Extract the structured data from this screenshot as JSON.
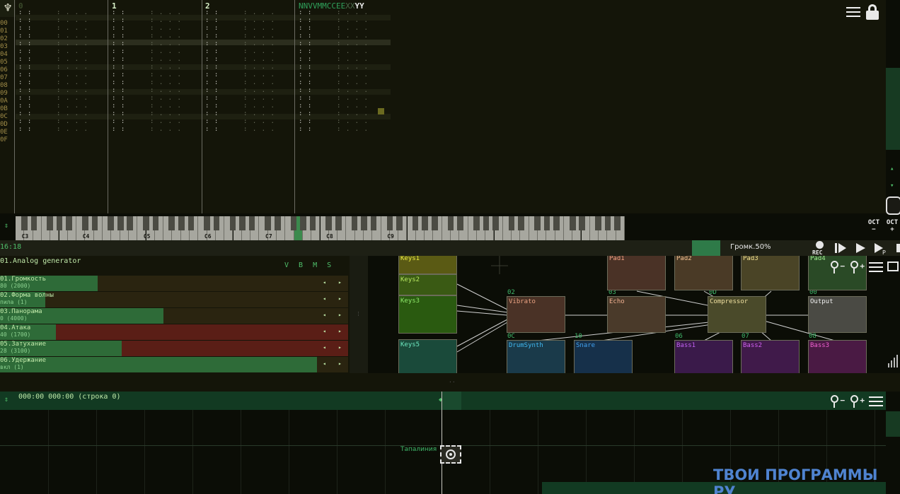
{
  "pattern": {
    "channels": [
      {
        "num": "0"
      },
      {
        "num": "1"
      },
      {
        "num": "2"
      }
    ],
    "columns_header_green": "NNVVMMCCEE",
    "columns_header_dim": "XX",
    "columns_header_white": "YY",
    "row_numbers": "00\n01\n02\n03\n04\n05\n06\n07\n08\n09\n0A\n0B\n0C\n0D\n0E\n0F"
  },
  "piano": {
    "octaves": [
      "C3",
      "C4",
      "C5",
      "C6",
      "C7",
      "C8",
      "C9"
    ],
    "oct_down": "OCT\n−",
    "oct_up": "OCT\n+"
  },
  "status": {
    "time": "16:18",
    "volume_label": "Громк.50%",
    "rec_label": "REC"
  },
  "module": {
    "title": "01.Analog generator",
    "vbms": [
      "V",
      "B",
      "M",
      "S"
    ],
    "params": [
      {
        "name": "01.Громкость",
        "value": "80 (2000)",
        "fill": 0.28,
        "red": 0
      },
      {
        "name": "02.Форма волны",
        "value": "пила (1)",
        "fill": 0.13,
        "red": 0
      },
      {
        "name": "03.Панорама",
        "value": "0 (4000)",
        "fill": 0.47,
        "red": 0
      },
      {
        "name": "04.Атака",
        "value": "40 (1700)",
        "fill": 0.16,
        "red": 1
      },
      {
        "name": "05.Затухание",
        "value": "28 (3100)",
        "fill": 0.35,
        "red": 1
      },
      {
        "name": "06.Удержание",
        "value": "вкл (1)",
        "fill": 0.91,
        "red": 0
      }
    ]
  },
  "graph": {
    "nodes": [
      {
        "label": "Keys1",
        "id": ""
      },
      {
        "label": "Keys2",
        "id": ""
      },
      {
        "label": "Keys3",
        "id": ""
      },
      {
        "label": "Keys5",
        "id": ""
      },
      {
        "label": "Vibrato",
        "id": "02"
      },
      {
        "label": "Echo",
        "id": "03"
      },
      {
        "label": "Compressor",
        "id": "0D"
      },
      {
        "label": "Output",
        "id": "00"
      },
      {
        "label": "Pad1",
        "id": ""
      },
      {
        "label": "Pad2",
        "id": ""
      },
      {
        "label": "Pad3",
        "id": ""
      },
      {
        "label": "Pad4",
        "id": ""
      },
      {
        "label": "DrumSynth",
        "id": "0C"
      },
      {
        "label": "Snare",
        "id": "10"
      },
      {
        "label": "Bass1",
        "id": "06"
      },
      {
        "label": "Bass2",
        "id": "07"
      },
      {
        "label": "Bass3",
        "id": "08"
      }
    ]
  },
  "timeline": {
    "position": "000:00  000:00 (строка 0)",
    "track_label": "Тапалиния"
  },
  "watermark": "ТВОИ ПРОГРАММЫ РУ"
}
